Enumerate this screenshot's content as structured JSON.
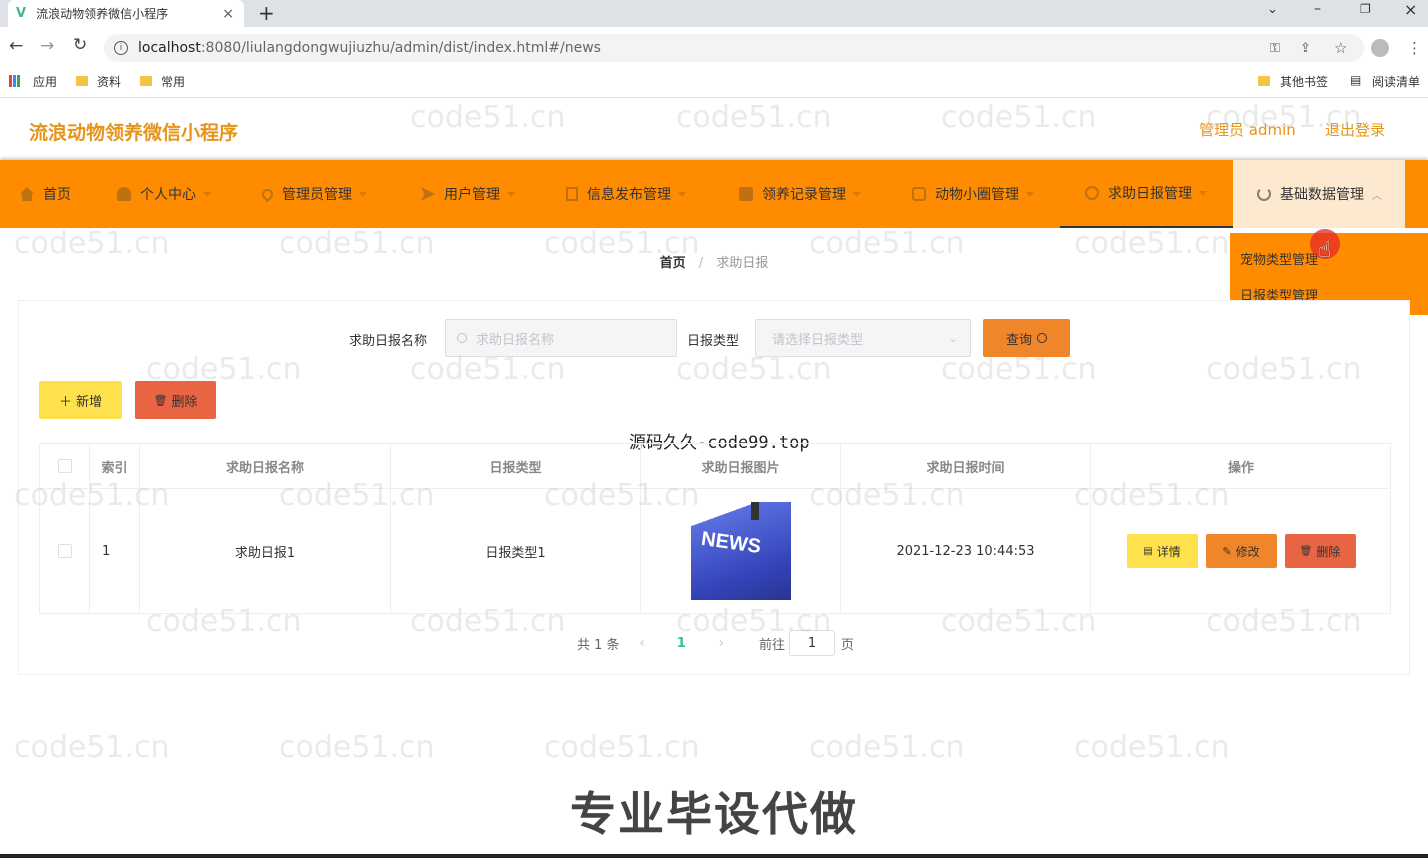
{
  "browser": {
    "tab_title": "流浪动物领养微信小程序",
    "new_tab": "+",
    "url_host": "localhost",
    "url_rest": ":8080/liulangdongwujiuzhu/admin/dist/index.html#/news",
    "bookmarks": [
      "应用",
      "资料",
      "常用"
    ],
    "bookmarks_right": [
      "其他书签",
      "阅读清单"
    ]
  },
  "header": {
    "app_title": "流浪动物领养微信小程序",
    "user_label": "管理员 admin",
    "logout": "退出登录"
  },
  "nav": {
    "items": [
      {
        "label": "首页",
        "icon": "home-icon"
      },
      {
        "label": "个人中心",
        "icon": "user-icon"
      },
      {
        "label": "管理员管理",
        "icon": "location-icon"
      },
      {
        "label": "用户管理",
        "icon": "send-icon"
      },
      {
        "label": "信息发布管理",
        "icon": "doc-icon"
      },
      {
        "label": "领养记录管理",
        "icon": "folder-icon"
      },
      {
        "label": "动物小圈管理",
        "icon": "chat-icon"
      },
      {
        "label": "求助日报管理",
        "icon": "info-icon"
      },
      {
        "label": "基础数据管理",
        "icon": "power-icon"
      }
    ],
    "dropdown": [
      "宠物类型管理",
      "日报类型管理"
    ]
  },
  "breadcrumb": {
    "home": "首页",
    "sep": "/",
    "current": "求助日报"
  },
  "search": {
    "name_label": "求助日报名称",
    "name_placeholder": "求助日报名称",
    "type_label": "日报类型",
    "type_placeholder": "请选择日报类型",
    "query_button": "查询"
  },
  "actions": {
    "add": "新增",
    "delete": "删除"
  },
  "overlay_text": "源码久久-code99.top",
  "table": {
    "headers": [
      "索引",
      "求助日报名称",
      "日报类型",
      "求助日报图片",
      "求助日报时间",
      "操作"
    ],
    "rows": [
      {
        "index": "1",
        "name": "求助日报1",
        "type": "日报类型1",
        "image_text": "NEWS",
        "time": "2021-12-23 10:44:53"
      }
    ],
    "row_buttons": {
      "detail": "详情",
      "edit": "修改",
      "delete": "删除"
    }
  },
  "pagination": {
    "total": "共 1 条",
    "current": "1",
    "goto": "前往",
    "page_value": "1",
    "page_suffix": "页"
  },
  "watermark": "code51.cn",
  "banner": "专业毕设代做",
  "colors": {
    "accent": "#ff8c00",
    "yellow": "#ffe14d",
    "orange": "#f0862a",
    "red": "#e86443",
    "title": "#e6941a"
  }
}
